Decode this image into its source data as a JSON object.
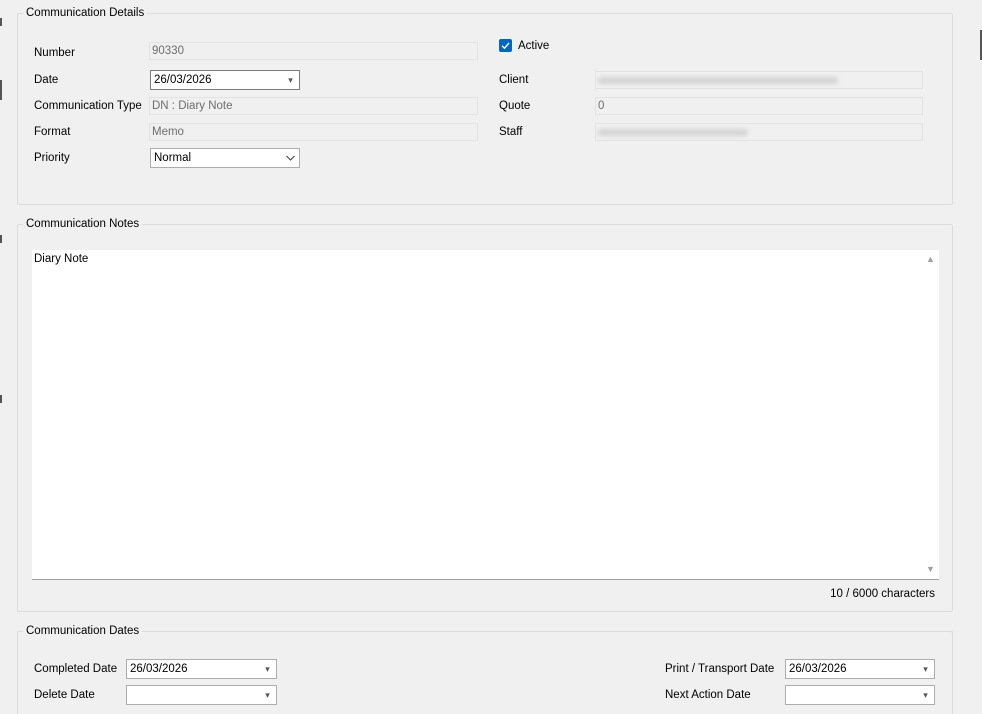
{
  "details": {
    "title": "Communication Details",
    "number_label": "Number",
    "number_value": "90330",
    "date_label": "Date",
    "date_value": "26/03/2026",
    "comm_type_label": "Communication Type",
    "comm_type_value": "DN : Diary Note",
    "format_label": "Format",
    "format_value": "Memo",
    "priority_label": "Priority",
    "priority_value": "Normal",
    "active_label": "Active",
    "active_checked": true,
    "client_label": "Client",
    "quote_label": "Quote",
    "quote_value": "0",
    "staff_label": "Staff"
  },
  "notes": {
    "title": "Communication Notes",
    "text": "Diary Note",
    "char_count": "10 / 6000 characters"
  },
  "dates": {
    "title": "Communication Dates",
    "completed_label": "Completed Date",
    "completed_value": "26/03/2026",
    "delete_label": "Delete Date",
    "delete_value": "",
    "print_label": "Print / Transport Date",
    "print_value": "26/03/2026",
    "next_action_label": "Next Action Date",
    "next_action_value": ""
  },
  "icons": {
    "dropdown": "chevron-down-icon",
    "check": "checkmark-icon",
    "scroll_up": "scroll-up-arrow-icon",
    "scroll_down": "scroll-down-arrow-icon"
  },
  "colors": {
    "window_bg": "#f0f0f0",
    "checkbox_accent": "#0067c0",
    "readonly_text": "#6d6d6d",
    "group_border": "#dcdcdc"
  }
}
